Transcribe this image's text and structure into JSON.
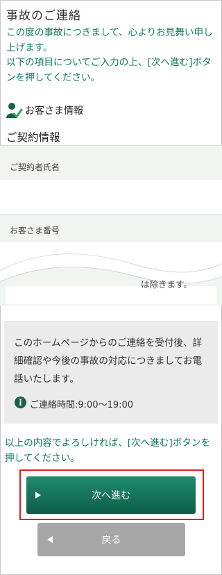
{
  "page": {
    "title": "事故のご連絡",
    "intro_line1": "この度の事故につきまして、心よりお見舞い申し上げます。",
    "intro_line2": "以下の項目についてご入力の上、[次へ進む]ボタンを押してください。"
  },
  "customer_section": {
    "label": "お客さま情報",
    "icon": "user-check-icon"
  },
  "contract_section": {
    "heading": "ご契約情報",
    "fields": [
      {
        "label": "ご契約者氏名",
        "value": ""
      },
      {
        "label": "お客さま番号",
        "value": ""
      }
    ],
    "partial_text": "は除きます。"
  },
  "notice": {
    "text": "このホームページからのご連絡を受付後、詳細確認や今後の事故の対応につきましてお電話いたします。",
    "hours": "ご連絡時間:9:00〜19:00",
    "icon": "info-icon"
  },
  "confirm_text": "以上の内容でよろしければ、[次へ進む]ボタンを押してください。",
  "buttons": {
    "next": "次へ進む",
    "back": "戻る"
  },
  "colors": {
    "accent_green": "#0f7a5f",
    "highlight_red": "#e51b1b",
    "back_gray": "#a7a7a7"
  }
}
